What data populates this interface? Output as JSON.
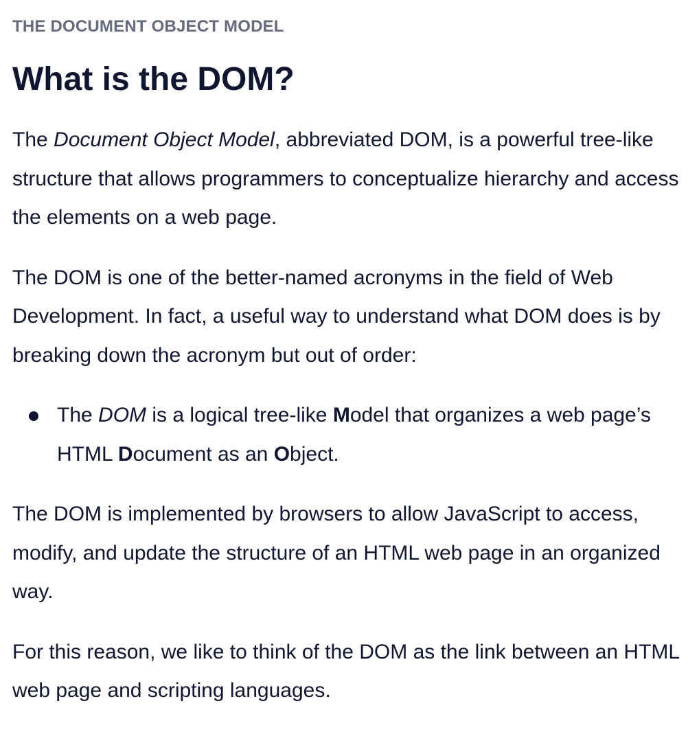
{
  "article": {
    "eyebrow": "THE DOCUMENT OBJECT MODEL",
    "title": "What is the DOM?",
    "p1": {
      "a": "The ",
      "em": "Document Object Model",
      "b": ", abbreviated DOM, is a powerful tree-like structure that allows programmers to conceptualize hierarchy and access the elements on a web page."
    },
    "p2": "The DOM is one of the better-named acronyms in the field of Web Development. In fact, a useful way to understand what DOM does is by breaking down the acronym but out of order:",
    "bullet": {
      "a": "The ",
      "em": "DOM",
      "b": " is a logical tree-like ",
      "m": "M",
      "c": "odel that organizes a web page’s HTML ",
      "d": "D",
      "e": "ocument as an ",
      "o": "O",
      "f": "bject."
    },
    "p3": "The DOM is implemented by browsers to allow JavaScript to access, modify, and update the structure of an HTML web page in an organized way.",
    "p4": "For this reason, we like to think of the DOM as the link between an HTML web page and scripting languages."
  }
}
